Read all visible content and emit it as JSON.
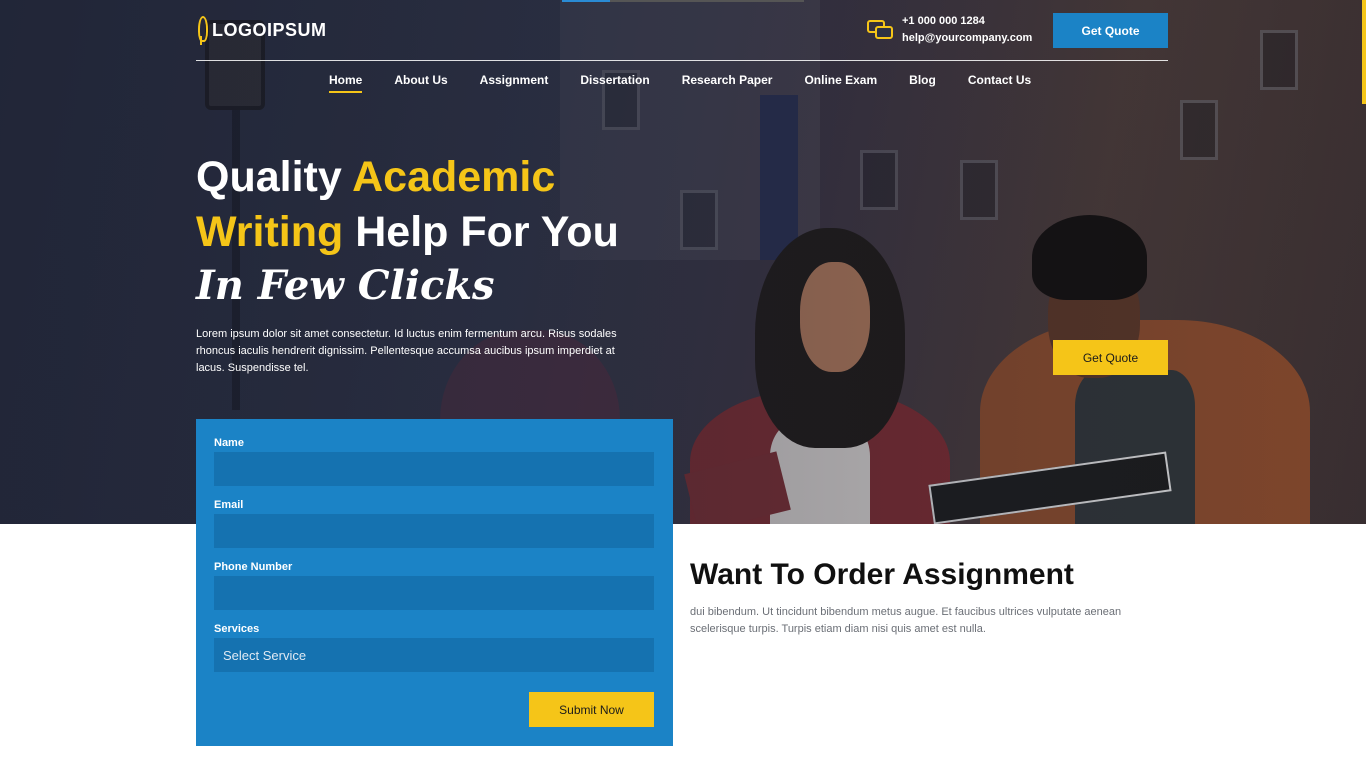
{
  "logo": {
    "text": "LOGOIPSUM"
  },
  "contact": {
    "phone": "+1 000 000 1284",
    "email": "help@yourcompany.com"
  },
  "header": {
    "get_quote_label": "Get Quote"
  },
  "nav": {
    "items": [
      {
        "label": "Home",
        "active": true
      },
      {
        "label": "About Us",
        "active": false
      },
      {
        "label": "Assignment",
        "active": false
      },
      {
        "label": "Dissertation",
        "active": false
      },
      {
        "label": "Research Paper",
        "active": false
      },
      {
        "label": "Online Exam",
        "active": false
      },
      {
        "label": "Blog",
        "active": false
      },
      {
        "label": "Contact Us",
        "active": false
      }
    ]
  },
  "hero": {
    "title_part1": "Quality ",
    "title_highlight1": "Academic",
    "title_highlight2": "Writing",
    "title_part2": " Help For You",
    "subtitle": "In Few Clicks",
    "description": "Lorem ipsum dolor sit amet consectetur. Id luctus enim fermentum arcu. Risus sodales rhoncus iaculis hendrerit dignissim. Pellentesque accumsa aucibus ipsum imperdiet at lacus. Suspendisse tel.",
    "get_quote_label": "Get Quote"
  },
  "form": {
    "name_label": "Name",
    "name_value": "",
    "email_label": "Email",
    "email_value": "",
    "phone_label": "Phone Number",
    "phone_value": "",
    "services_label": "Services",
    "services_selected": "Select Service",
    "submit_label": "Submit Now"
  },
  "order": {
    "title": "Want To Order Assignment",
    "description": "dui bibendum. Ut tincidunt bibendum metus augue. Et faucibus ultrices vulputate aenean scelerisque turpis. Turpis etiam diam nisi quis amet est nulla."
  },
  "colors": {
    "primary_blue": "#1b83c6",
    "accent_yellow": "#f5c518",
    "field_blue": "#1572b0",
    "heading_dark": "#101010"
  },
  "icons": {
    "logo": "wheat-leaf-icon",
    "contact": "chat-bubbles-icon"
  }
}
